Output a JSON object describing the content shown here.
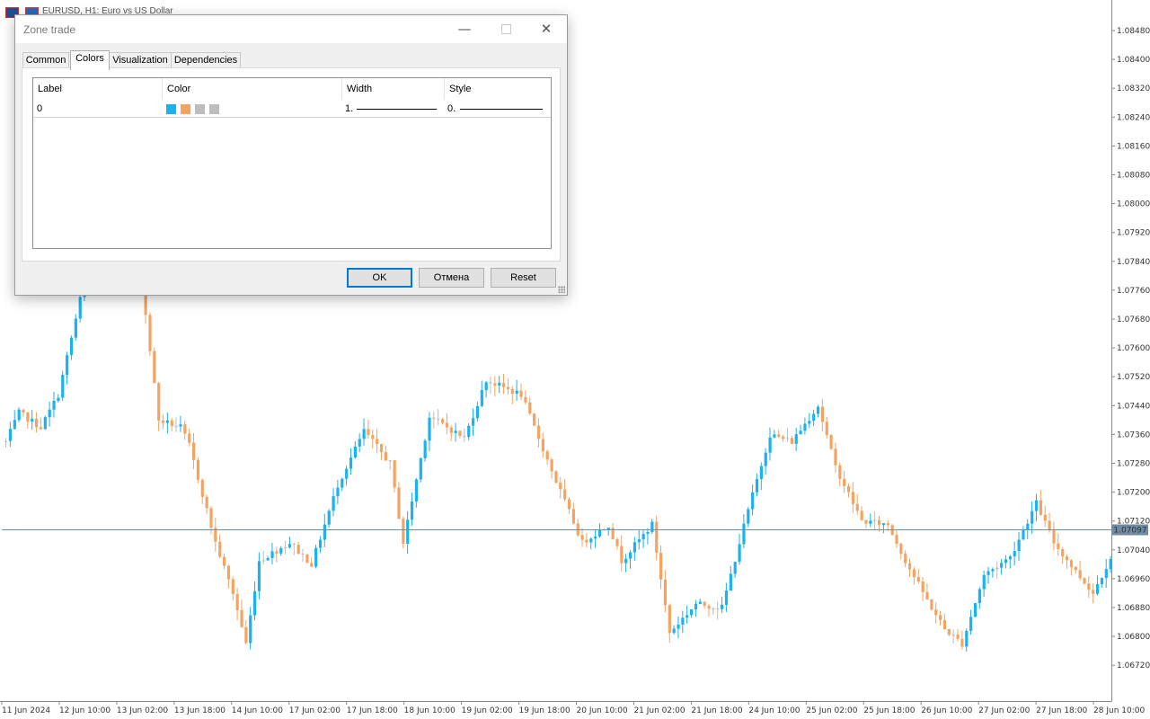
{
  "window": {
    "title": "EURUSD, H1:  Euro vs US Dollar"
  },
  "dialog": {
    "title": "Zone trade",
    "tabs": [
      "Common",
      "Colors",
      "Visualization",
      "Dependencies"
    ],
    "active_tab": "Colors",
    "table": {
      "headers": [
        "Label",
        "Color",
        "Width",
        "Style"
      ],
      "rows": [
        {
          "label": "0",
          "colors": [
            "#1ab2ef",
            "#f4a460",
            "#bdbdbd",
            "#bdbdbd"
          ],
          "width": "1.",
          "style": "0."
        }
      ]
    },
    "buttons": {
      "ok": "OK",
      "cancel": "Отмена",
      "reset": "Reset"
    }
  },
  "chart": {
    "symbol": "EURUSD",
    "timeframe": "H1",
    "current_price": "1.07097",
    "colors": {
      "up": "#1ab2ef",
      "down": "#f4a460",
      "neutral": "#bdbdbd",
      "price_line": "#6a8fb0"
    },
    "y_labels": [
      "1.08480",
      "1.08400",
      "1.08320",
      "1.08240",
      "1.08160",
      "1.08080",
      "1.08000",
      "1.07920",
      "1.07840",
      "1.07760",
      "1.07680",
      "1.07600",
      "1.07520",
      "1.07440",
      "1.07360",
      "1.07280",
      "1.07200",
      "1.07120",
      "1.07040",
      "1.06960",
      "1.06880",
      "1.06800",
      "1.06720"
    ],
    "x_labels": [
      "11 Jun 2024",
      "12 Jun 10:00",
      "13 Jun 02:00",
      "13 Jun 18:00",
      "14 Jun 10:00",
      "17 Jun 02:00",
      "17 Jun 18:00",
      "18 Jun 10:00",
      "19 Jun 02:00",
      "19 Jun 18:00",
      "20 Jun 10:00",
      "21 Jun 02:00",
      "21 Jun 18:00",
      "24 Jun 10:00",
      "25 Jun 02:00",
      "25 Jun 18:00",
      "26 Jun 10:00",
      "27 Jun 02:00",
      "27 Jun 18:00",
      "28 Jun 10:00"
    ],
    "y_range": [
      1.0668,
      1.0852
    ],
    "trend": [
      [
        0,
        1.0734
      ],
      [
        3,
        1.0742
      ],
      [
        8,
        1.0738
      ],
      [
        12,
        1.0747
      ],
      [
        16,
        1.0768
      ],
      [
        20,
        1.079
      ],
      [
        25,
        1.0808
      ],
      [
        31,
        1.0779
      ],
      [
        35,
        1.074
      ],
      [
        40,
        1.0738
      ],
      [
        42,
        1.0733
      ],
      [
        48,
        1.0706
      ],
      [
        52,
        1.0692
      ],
      [
        55,
        1.0678
      ],
      [
        58,
        1.0701
      ],
      [
        65,
        1.0706
      ],
      [
        70,
        1.07
      ],
      [
        76,
        1.0722
      ],
      [
        82,
        1.0737
      ],
      [
        88,
        1.0728
      ],
      [
        91,
        1.0706
      ],
      [
        97,
        1.0741
      ],
      [
        105,
        1.0735
      ],
      [
        110,
        1.0751
      ],
      [
        118,
        1.0747
      ],
      [
        126,
        1.0723
      ],
      [
        132,
        1.0706
      ],
      [
        138,
        1.0711
      ],
      [
        141,
        1.0701
      ],
      [
        148,
        1.0711
      ],
      [
        152,
        1.0681
      ],
      [
        158,
        1.0689
      ],
      [
        164,
        1.0688
      ],
      [
        170,
        1.0715
      ],
      [
        175,
        1.0736
      ],
      [
        180,
        1.0734
      ],
      [
        186,
        1.0744
      ],
      [
        190,
        1.0727
      ],
      [
        196,
        1.0712
      ],
      [
        202,
        1.0711
      ],
      [
        206,
        1.0701
      ],
      [
        211,
        1.069
      ],
      [
        215,
        1.0682
      ],
      [
        219,
        1.0678
      ],
      [
        224,
        1.0697
      ],
      [
        230,
        1.0702
      ],
      [
        236,
        1.0717
      ],
      [
        240,
        1.0706
      ],
      [
        245,
        1.0698
      ],
      [
        249,
        1.0692
      ],
      [
        253,
        1.0702
      ]
    ]
  }
}
